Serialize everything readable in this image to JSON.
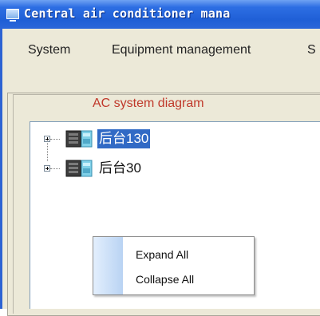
{
  "window": {
    "title": "Central air conditioner mana"
  },
  "menu": {
    "items": [
      {
        "label": "System"
      },
      {
        "label": "Equipment management"
      },
      {
        "label": "S"
      }
    ]
  },
  "panel": {
    "title": "AC system diagram"
  },
  "tree": {
    "nodes": [
      {
        "label": "后台130",
        "selected": true,
        "icon": "ac-unit-icon"
      },
      {
        "label": "后台30",
        "selected": false,
        "icon": "ac-unit-icon"
      }
    ]
  },
  "context_menu": {
    "items": [
      {
        "label": "Expand All"
      },
      {
        "label": "Collapse All"
      }
    ]
  },
  "colors": {
    "title_bar": "#2d6ee3",
    "selection": "#316ac5",
    "panel_title": "#c0392b",
    "background": "#ece9d8"
  }
}
